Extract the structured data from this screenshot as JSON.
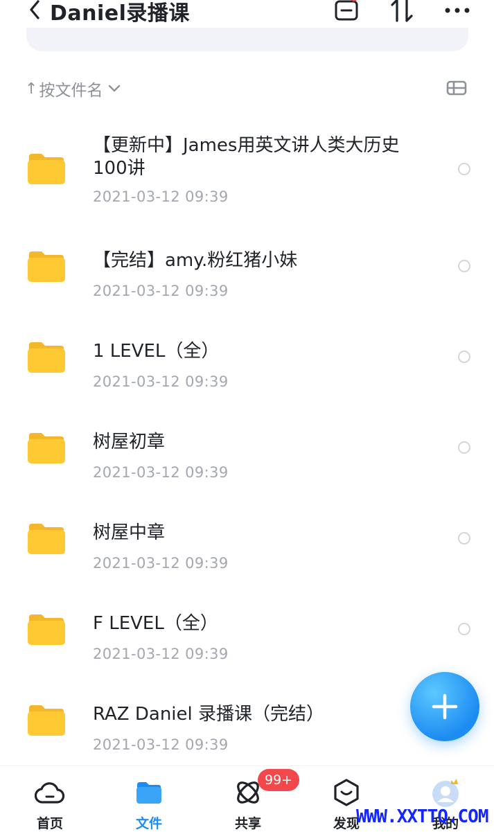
{
  "header": {
    "title": "Daniel录播课"
  },
  "sort": {
    "arrow": "↑",
    "label": "按文件名"
  },
  "files": [
    {
      "name": "【更新中】James用英文讲人类大历史100讲",
      "date": "2021-03-12 09:39"
    },
    {
      "name": "【完结】amy.粉红猪小妹",
      "date": "2021-03-12 09:39"
    },
    {
      "name": "1 LEVEL（全）",
      "date": "2021-03-12 09:39"
    },
    {
      "name": "树屋初章",
      "date": "2021-03-12 09:39"
    },
    {
      "name": "树屋中章",
      "date": "2021-03-12 09:39"
    },
    {
      "name": "F LEVEL（全）",
      "date": "2021-03-12 09:39"
    },
    {
      "name": "RAZ Daniel 录播课（完结）",
      "date": "2021-03-12 09:39"
    }
  ],
  "tabs": [
    {
      "label": "首页",
      "icon": "cloud-icon"
    },
    {
      "label": "文件",
      "icon": "folder-icon"
    },
    {
      "label": "共享",
      "icon": "orbit-icon"
    },
    {
      "label": "发现",
      "icon": "discover-box-icon"
    },
    {
      "label": "我的",
      "icon": "avatar-icon"
    }
  ],
  "share_badge": "99+",
  "watermark": "WWW.XXTTQ.COM",
  "colors": {
    "accent": "#1d8cf2",
    "badge": "#f2474b",
    "folder": "#ffc933"
  }
}
